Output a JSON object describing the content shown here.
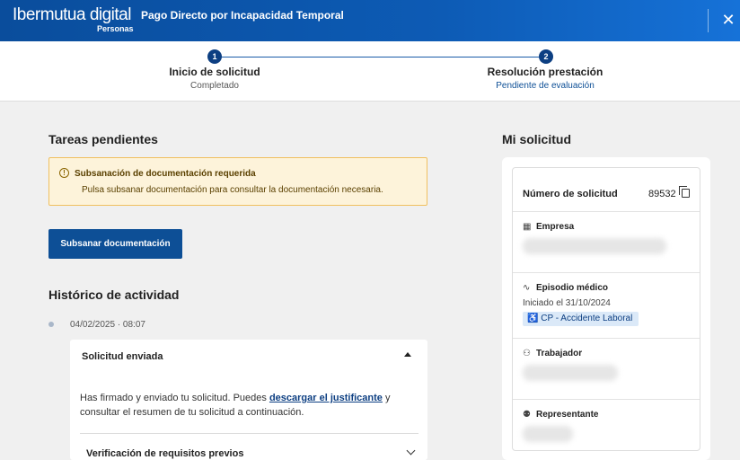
{
  "header": {
    "logo_text": "Ibermutua digital",
    "logo_sub": "Personas",
    "title": "Pago Directo por Incapacidad Temporal",
    "close_icon": "close-icon"
  },
  "stepper": {
    "steps": [
      {
        "number": "1",
        "title": "Inicio de solicitud",
        "status": "Completado"
      },
      {
        "number": "2",
        "title": "Resolución prestación",
        "status": "Pendiente de evaluación"
      }
    ]
  },
  "tasks": {
    "title": "Tareas pendientes",
    "alert_title": "Subsanación de documentación requerida",
    "alert_body": "Pulsa subsanar documentación para consultar la documentación necesaria.",
    "button_label": "Subsanar documentación"
  },
  "history": {
    "title": "Histórico de actividad",
    "date": "04/02/2025 · 08:07",
    "card_title": "Solicitud enviada",
    "text_before_link": "Has firmado y enviado tu solicitud. Puedes ",
    "link_text": "descargar el justificante",
    "text_after_link": " y consultar el resumen de tu solicitud a continuación.",
    "second_title": "Verificación de requisitos previos"
  },
  "solicitud": {
    "title": "Mi solicitud",
    "number_label": "Número de solicitud",
    "number_value": "89532",
    "empresa_label": "Empresa",
    "episodio_label": "Episodio médico",
    "episodio_date": "Iniciado el 31/10/2024",
    "episodio_tag": "CP - Accidente Laboral",
    "trabajador_label": "Trabajador",
    "representante_label": "Representante"
  },
  "colors": {
    "brand": "#0d4f96",
    "alert_bg": "#fdf3da",
    "tag_bg": "#dbe9f8"
  }
}
